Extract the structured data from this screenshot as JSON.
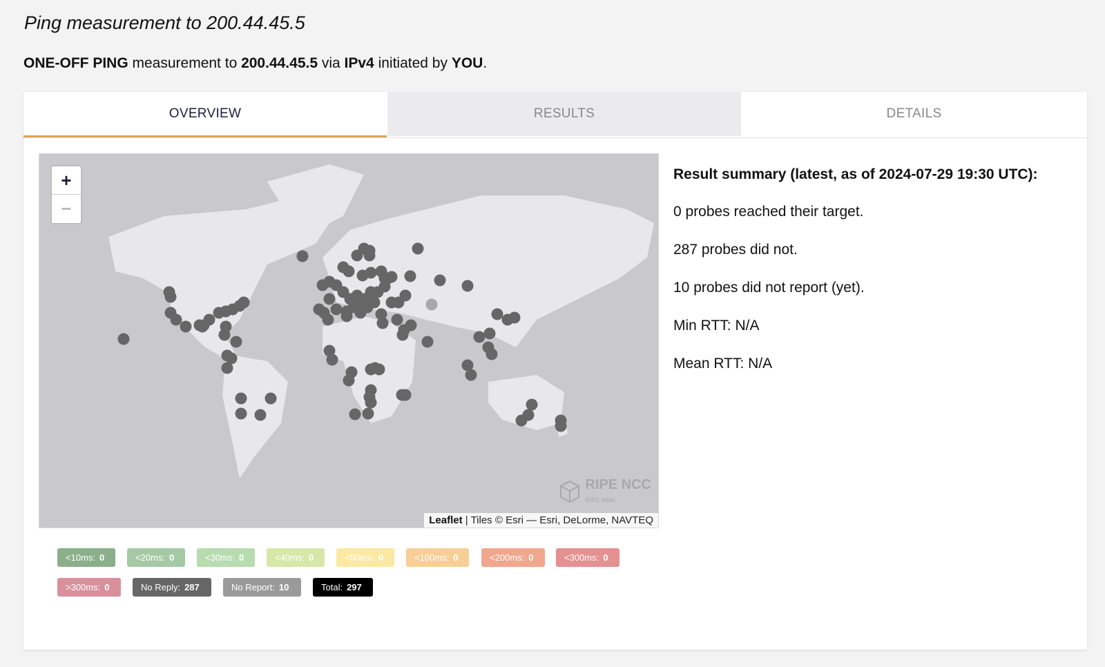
{
  "page": {
    "title": "Ping measurement to 200.44.45.5",
    "subtitle": {
      "type": "ONE-OFF PING",
      "t1": " measurement to ",
      "target": "200.44.45.5",
      "t2": " via ",
      "proto": "IPv4",
      "t3": " initiated by ",
      "owner": "YOU",
      "t4": "."
    }
  },
  "tabs": [
    {
      "label": "OVERVIEW",
      "active": true
    },
    {
      "label": "RESULTS",
      "active": false
    },
    {
      "label": "DETAILS",
      "active": false
    }
  ],
  "map": {
    "zoom_in": "+",
    "zoom_out": "−",
    "attribution_leaflet": "Leaflet",
    "attribution_rest": " | Tiles © Esri — Esri, DeLorme, NAVTEQ",
    "logo_text": "RIPE NCC",
    "logo_sub": "RIPE Atlas",
    "marker_color": "#666666",
    "noreport_color": "#a8a8a8"
  },
  "summary": {
    "heading": "Result summary (latest, as of 2024-07-29 19:30 UTC):",
    "reached": "0 probes reached their target.",
    "not_reached": "287 probes did not.",
    "no_report": "10 probes did not report (yet).",
    "min_rtt": "Min RTT: N/A",
    "mean_rtt": "Mean RTT: N/A"
  },
  "legend": [
    {
      "label": "<10ms:",
      "count": "0",
      "color": "#8aaf8a"
    },
    {
      "label": "<20ms:",
      "count": "0",
      "color": "#a5c9a5"
    },
    {
      "label": "<30ms:",
      "count": "0",
      "color": "#b7dcb0"
    },
    {
      "label": "<40ms:",
      "count": "0",
      "color": "#d6e7a8"
    },
    {
      "label": "<50ms:",
      "count": "0",
      "color": "#fbe9a3"
    },
    {
      "label": "<100ms:",
      "count": "0",
      "color": "#f7cf96"
    },
    {
      "label": "<200ms:",
      "count": "0",
      "color": "#f0a78e"
    },
    {
      "label": "<300ms:",
      "count": "0",
      "color": "#e59091"
    },
    {
      "label": ">300ms:",
      "count": "0",
      "color": "#d9909b"
    },
    {
      "label": "No Reply:",
      "count": "287",
      "color": "#666666"
    },
    {
      "label": "No Report:",
      "count": "10",
      "color": "#9a9a9a"
    },
    {
      "label": "Total:",
      "count": "297",
      "color": "#000000"
    }
  ]
}
